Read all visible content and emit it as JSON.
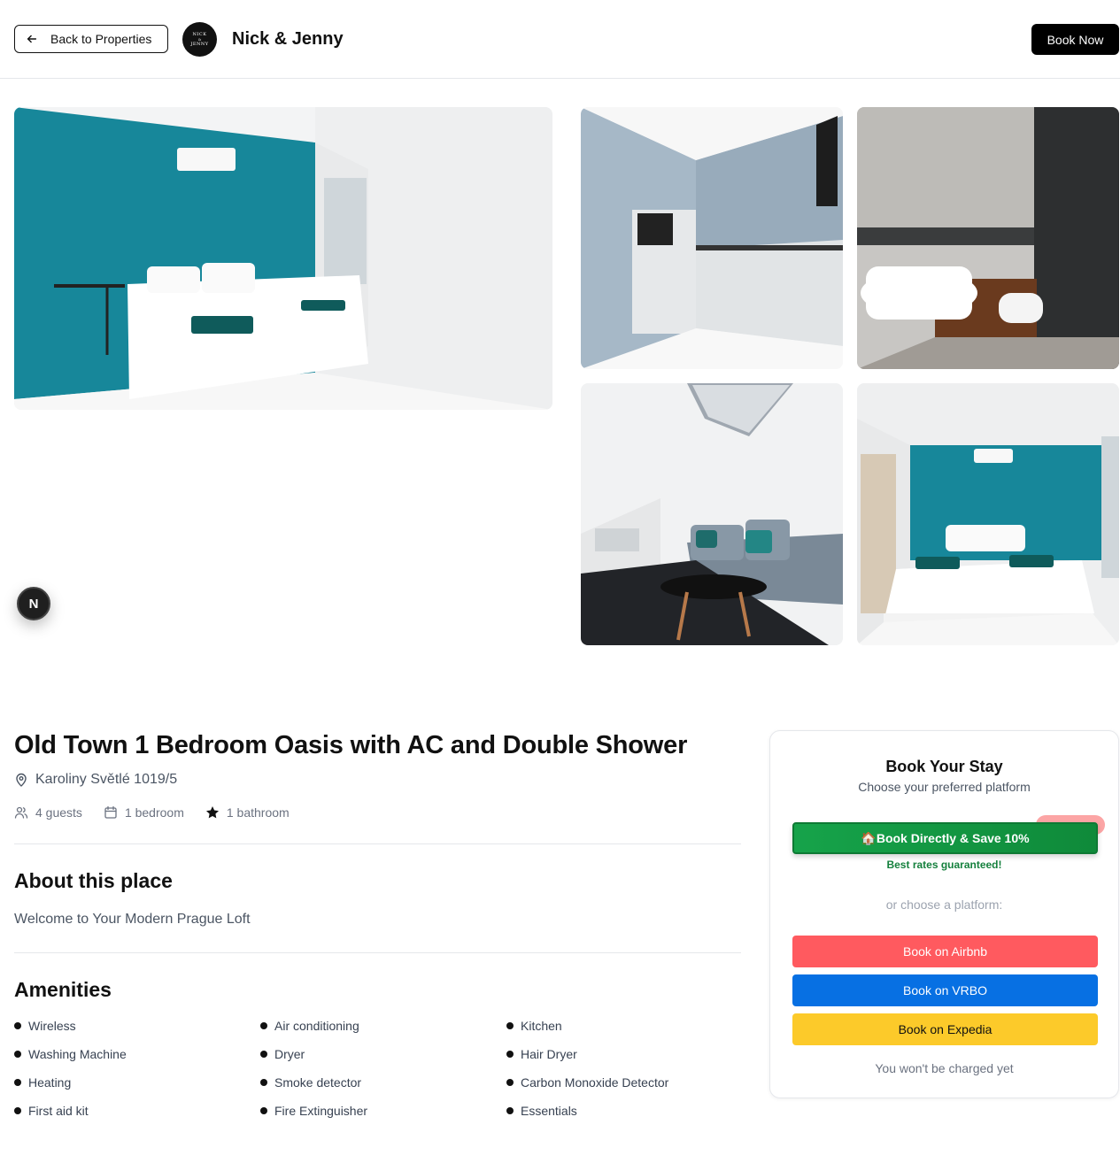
{
  "header": {
    "back_label": "Back to Properties",
    "logo": {
      "line1": "NICK",
      "line2": "&",
      "line3": "JENNY"
    },
    "brand": "Nick & Jenny",
    "book_now_label": "Book Now"
  },
  "gallery": {
    "photos": [
      "bedroom-teal-wall",
      "kitchen",
      "bathroom-double-shower",
      "living-room-skylight",
      "bedroom-wide-view"
    ]
  },
  "next_badge": {
    "letter": "N"
  },
  "property": {
    "title": "Old Town 1 Bedroom Oasis with AC and Double Shower",
    "address": "Karoliny Světlé 1019/5",
    "stats": {
      "guests": "4 guests",
      "bedrooms": "1 bedroom",
      "bathrooms": "1 bathroom"
    },
    "about_heading": "About this place",
    "about_text": "Welcome to Your Modern Prague Loft",
    "amenities_heading": "Amenities",
    "amenities": [
      "Wireless",
      "Air conditioning",
      "Kitchen",
      "Washing Machine",
      "Dryer",
      "Hair Dryer",
      "Heating",
      "Smoke detector",
      "Carbon Monoxide Detector",
      "First aid kit",
      "Fire Extinguisher",
      "Essentials"
    ]
  },
  "booking": {
    "title": "Book Your Stay",
    "subtitle": "Choose your preferred platform",
    "direct_label": "🏠Book Directly & Save 10%",
    "best_rates": "Best rates guaranteed!",
    "or_choose": "or choose a platform:",
    "airbnb_label": "Book on Airbnb",
    "vrbo_label": "Book on VRBO",
    "expedia_label": "Book on Expedia",
    "no_charge": "You won't be charged yet"
  },
  "colors": {
    "airbnb": "#ff5a5f",
    "vrbo": "#0770e3",
    "expedia": "#fcca2a",
    "direct": "#16a34a",
    "teal_wall": "#1a8a9a"
  }
}
